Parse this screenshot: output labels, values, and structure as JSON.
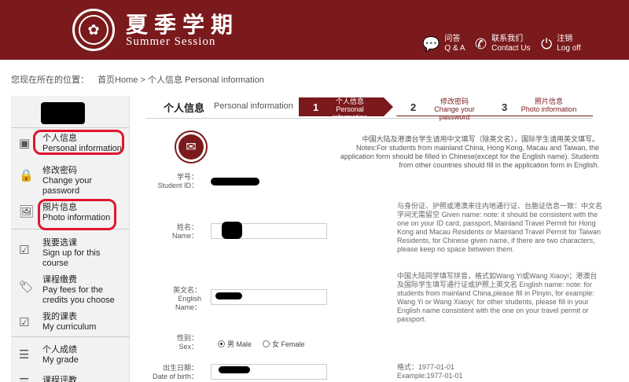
{
  "header": {
    "logo_icon": "university-seal-icon",
    "brand_cn": "夏季学期",
    "brand_en": "Summer Session",
    "nav": [
      {
        "icon": "chat-bubble-icon",
        "cn": "问答",
        "en": "Q & A"
      },
      {
        "icon": "phone-icon",
        "cn": "联系我们",
        "en": "Contact Us"
      },
      {
        "icon": "power-icon",
        "cn": "注销",
        "en": "Log off"
      }
    ]
  },
  "breadcrumb": {
    "prefix": "您现在所在的位置：",
    "home": "首页Home",
    "sep": ">",
    "current": "个人信息 Personal information"
  },
  "sidebar": {
    "items": [
      {
        "icon": "id-card-icon",
        "cn": "个人信息",
        "en": "Personal information"
      },
      {
        "icon": "lock-icon",
        "cn": "修改密码",
        "en": "Change your password"
      },
      {
        "icon": "photo-icon",
        "cn": "照片信息",
        "en": "Photo information"
      },
      {
        "icon": "checkbox-icon",
        "cn": "我要选课",
        "en": "Sign up for this course"
      },
      {
        "icon": "price-tag-icon",
        "cn": "课程缴费",
        "en": "Pay fees for the credits you choose"
      },
      {
        "icon": "checkbox-icon",
        "cn": "我的课表",
        "en": "My curriculum"
      },
      {
        "icon": "list-icon",
        "cn": "个人成绩",
        "en": "My grade"
      },
      {
        "icon": "list-icon",
        "cn": "课程评教",
        "en": ""
      }
    ]
  },
  "page": {
    "title_cn": "个人信息",
    "title_en": "Personal information",
    "steps": [
      {
        "num": "1",
        "cn": "个人信息",
        "en": "Personal information"
      },
      {
        "num": "2",
        "cn": "修改密码",
        "en": "Change your password"
      },
      {
        "num": "3",
        "cn": "照片信息",
        "en": "Photo information"
      }
    ],
    "note_top": "中国大陆及港澳台学生请用中文填写（除英文名），国际学生请用英文填写。Notes:For students from mainland China, Hong Kong, Macau and Taiwan, the application form should be filled in Chinese(except for the English name). Students from other countries should fill in the application form in English.",
    "fields": {
      "student_id": {
        "cn": "学号：",
        "en": "Student ID："
      },
      "name": {
        "cn": "姓名：",
        "en": "Name：",
        "note": "与身份证、护照或港澳来往内地通行证、台胞证信息一致：中文名字间无需留空 Given name: note: it should be consistent with the one on your ID card, passport, Mainland Travel Permit for Hong Kong and Macau Residents or Mainland Travel Permit for Taiwan Residents, for Chinese given name, if there are two characters, please keep no space between them."
      },
      "english_name": {
        "cn": "英文名：",
        "en1": "English",
        "en2": "Name：",
        "note": "中国大陆同学填写拼音，格式如Wang Yi或Wang Xiaoyi；港澳台及国际学生填写通行证或护照上英文名 English name: note: for students from mainland China,please fill in Pinyin, for example: Wang Yi or Wang Xiaoyi; for other students, please fill in your English name consistent with the one on your travel permit or passport."
      },
      "sex": {
        "cn": "性别：",
        "en": "Sex：",
        "male": "男 Male",
        "female": "女 Female"
      },
      "dob": {
        "cn": "出生日期：",
        "en": "Date of birth：",
        "note1": "格式：1977-01-01",
        "note2": "Example:1977-01-01"
      }
    }
  }
}
